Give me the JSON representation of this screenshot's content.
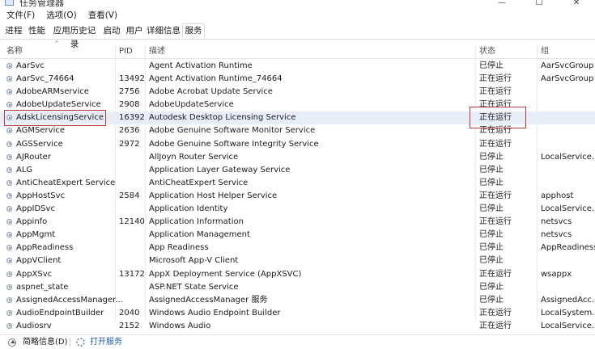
{
  "window": {
    "title": "任务管理器"
  },
  "menu": [
    "文件(F)",
    "选项(O)",
    "查看(V)"
  ],
  "tabs": [
    {
      "label": "进程"
    },
    {
      "label": "性能"
    },
    {
      "label": "应用历史记录"
    },
    {
      "label": "启动"
    },
    {
      "label": "用户"
    },
    {
      "label": "详细信息"
    },
    {
      "label": "服务",
      "active": true
    }
  ],
  "columns": {
    "name": "名称",
    "pid": "PID",
    "desc": "描述",
    "status": "状态",
    "group": "组"
  },
  "rows": [
    {
      "name": "AarSvc",
      "pid": "",
      "desc": "Agent Activation Runtime",
      "status": "已停止",
      "group": "AarSvcGroup"
    },
    {
      "name": "AarSvc_74664",
      "pid": "13492",
      "desc": "Agent Activation Runtime_74664",
      "status": "正在运行",
      "group": "AarSvcGroup"
    },
    {
      "name": "AdobeARMservice",
      "pid": "2756",
      "desc": "Adobe Acrobat Update Service",
      "status": "正在运行",
      "group": ""
    },
    {
      "name": "AdobeUpdateService",
      "pid": "2908",
      "desc": "AdobeUpdateService",
      "status": "正在运行",
      "group": ""
    },
    {
      "name": "AdskLicensingService",
      "pid": "16392",
      "desc": "Autodesk Desktop Licensing Service",
      "status": "正在运行",
      "group": "",
      "selected": true
    },
    {
      "name": "AGMService",
      "pid": "2636",
      "desc": "Adobe Genuine Software Monitor Service",
      "status": "正在运行",
      "group": ""
    },
    {
      "name": "AGSService",
      "pid": "2972",
      "desc": "Adobe Genuine Software Integrity Service",
      "status": "正在运行",
      "group": ""
    },
    {
      "name": "AJRouter",
      "pid": "",
      "desc": "AllJoyn Router Service",
      "status": "已停止",
      "group": "LocalService..."
    },
    {
      "name": "ALG",
      "pid": "",
      "desc": "Application Layer Gateway Service",
      "status": "已停止",
      "group": ""
    },
    {
      "name": "AntiCheatExpert Service",
      "pid": "",
      "desc": "AntiCheatExpert Service",
      "status": "已停止",
      "group": ""
    },
    {
      "name": "AppHostSvc",
      "pid": "2584",
      "desc": "Application Host Helper Service",
      "status": "正在运行",
      "group": "apphost"
    },
    {
      "name": "AppIDSvc",
      "pid": "",
      "desc": "Application Identity",
      "status": "已停止",
      "group": "LocalService..."
    },
    {
      "name": "Appinfo",
      "pid": "12140",
      "desc": "Application Information",
      "status": "正在运行",
      "group": "netsvcs"
    },
    {
      "name": "AppMgmt",
      "pid": "",
      "desc": "Application Management",
      "status": "已停止",
      "group": "netsvcs"
    },
    {
      "name": "AppReadiness",
      "pid": "",
      "desc": "App Readiness",
      "status": "已停止",
      "group": "AppReadiness"
    },
    {
      "name": "AppVClient",
      "pid": "",
      "desc": "Microsoft App-V Client",
      "status": "已停止",
      "group": ""
    },
    {
      "name": "AppXSvc",
      "pid": "13172",
      "desc": "AppX Deployment Service (AppXSVC)",
      "status": "正在运行",
      "group": "wsappx"
    },
    {
      "name": "aspnet_state",
      "pid": "",
      "desc": "ASP.NET State Service",
      "status": "已停止",
      "group": ""
    },
    {
      "name": "AssignedAccessManager...",
      "pid": "",
      "desc": "AssignedAccessManager 服务",
      "status": "已停止",
      "group": "AssignedAcc..."
    },
    {
      "name": "AudioEndpointBuilder",
      "pid": "2040",
      "desc": "Windows Audio Endpoint Builder",
      "status": "正在运行",
      "group": "LocalSystem..."
    },
    {
      "name": "Audiosrv",
      "pid": "2152",
      "desc": "Windows Audio",
      "status": "正在运行",
      "group": "LocalService..."
    }
  ],
  "footer": {
    "less_details": "简略信息(D)",
    "open_services": "打开服务"
  }
}
